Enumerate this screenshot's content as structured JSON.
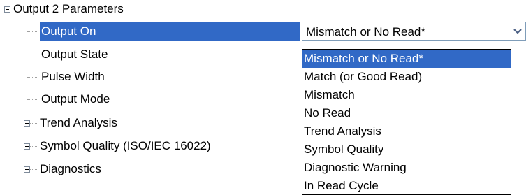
{
  "tree": {
    "root": {
      "label": "Output 2 Parameters",
      "expanded": true,
      "children": [
        {
          "label": "Output On",
          "selected": true
        },
        {
          "label": "Output State"
        },
        {
          "label": "Pulse Width"
        },
        {
          "label": "Output Mode"
        }
      ]
    },
    "siblings": [
      {
        "label": "Trend Analysis",
        "expanded": false
      },
      {
        "label": "Symbol Quality (ISO/IEC 16022)",
        "expanded": false
      },
      {
        "label": "Diagnostics",
        "expanded": false
      }
    ]
  },
  "combo": {
    "value": "Mismatch or No Read*",
    "open": true,
    "icon": "chevron-down-icon"
  },
  "dropdown": {
    "options": [
      "Mismatch or No Read*",
      "Match (or Good Read)",
      "Mismatch",
      "No Read",
      "Trend Analysis",
      "Symbol Quality",
      "Diagnostic Warning",
      "In Read Cycle"
    ],
    "selected_index": 0
  },
  "colors": {
    "selection": "#3169c6",
    "tree_lines": "#a0a0a0",
    "combo_border": "#7f9db9"
  }
}
